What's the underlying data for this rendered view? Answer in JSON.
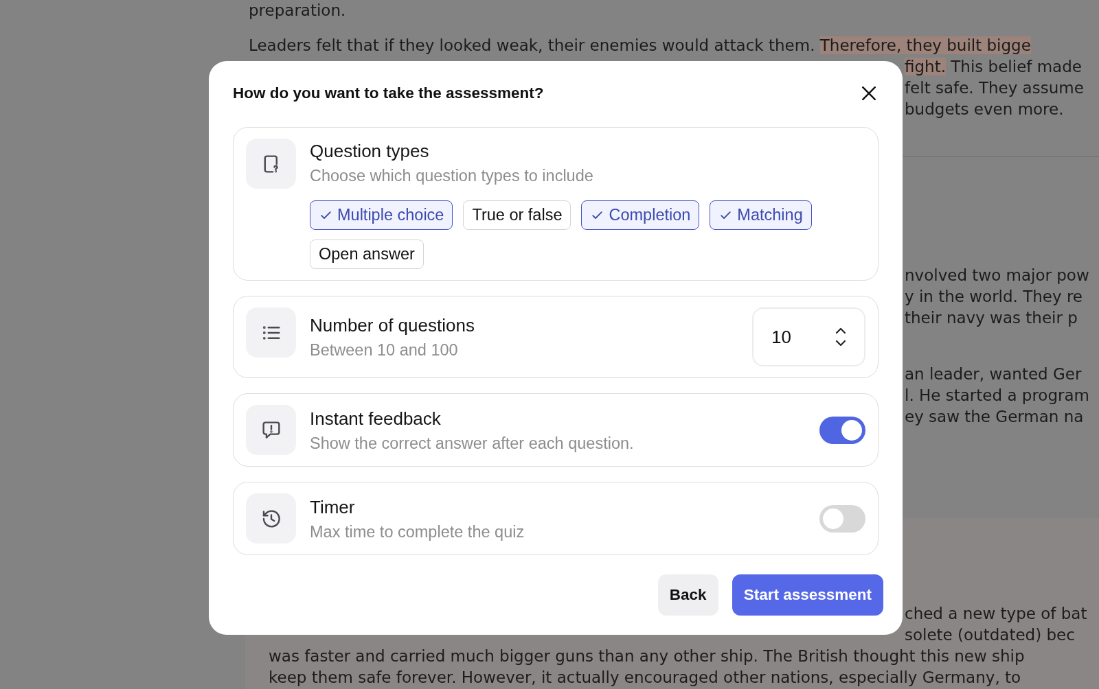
{
  "article": {
    "sections": [
      {
        "paragraphs": [
          {
            "lines": [
              {
                "kind": "full",
                "segments": [
                  {
                    "text": "preparation.",
                    "highlighted": false
                  }
                ]
              }
            ]
          },
          {
            "lines": [
              {
                "kind": "full",
                "segments": [
                  {
                    "text": "Leaders felt that if they looked weak, their enemies would attack them.",
                    "highlighted": false
                  },
                  {
                    "text": "Therefore, they built bigge",
                    "highlighted": true
                  }
                ]
              },
              {
                "kind": "right",
                "segments": [
                  {
                    "text": "fight.",
                    "highlighted": true
                  },
                  {
                    "text": "This belief made",
                    "highlighted": false
                  }
                ]
              },
              {
                "kind": "right",
                "segments": [
                  {
                    "text": "felt safe. They assume",
                    "highlighted": false
                  }
                ]
              },
              {
                "kind": "right",
                "segments": [
                  {
                    "text": "budgets even more.",
                    "highlighted": false
                  }
                ]
              }
            ]
          }
        ]
      },
      {
        "paragraphs": [
          {
            "lines": [
              {
                "kind": "right",
                "segments": [
                  {
                    "text": "nvolved two major pow",
                    "highlighted": false
                  }
                ]
              },
              {
                "kind": "right",
                "segments": [
                  {
                    "text": "y in the world. They re",
                    "highlighted": false
                  }
                ]
              },
              {
                "kind": "right",
                "segments": [
                  {
                    "text": "their navy was their p",
                    "highlighted": false
                  }
                ]
              }
            ]
          },
          {
            "lines": [
              {
                "kind": "right",
                "segments": [
                  {
                    "text": "an leader, wanted Ger",
                    "highlighted": false
                  }
                ]
              },
              {
                "kind": "right",
                "segments": [
                  {
                    "text": "l. He started a program",
                    "highlighted": false
                  }
                ]
              },
              {
                "kind": "right",
                "segments": [
                  {
                    "text": "ey saw the German na",
                    "highlighted": false
                  }
                ]
              }
            ]
          }
        ]
      }
    ],
    "callout": {
      "lines": [
        {
          "kind": "right",
          "segments": [
            {
              "text": "ched a new type of bat",
              "highlighted": false
            }
          ]
        },
        {
          "kind": "right",
          "segments": [
            {
              "text": "solete (outdated) bec",
              "highlighted": false
            }
          ]
        },
        {
          "kind": "full",
          "segments": [
            {
              "text": "was faster and carried much bigger guns than any other ship. The British thought this new ship",
              "highlighted": false
            }
          ]
        },
        {
          "kind": "full",
          "segments": [
            {
              "text": "keep them safe forever. However, it actually encouraged other nations, especially Germany, to",
              "highlighted": false
            }
          ]
        }
      ]
    }
  },
  "dialog": {
    "title": "How do you want to take the assessment?",
    "cards": [
      {
        "kind": "chips",
        "title": "Question types",
        "subtitle": "Choose which question types to include",
        "chips": [
          {
            "label": "Multiple choice",
            "selected": true
          },
          {
            "label": "True or false",
            "selected": false
          },
          {
            "label": "Completion",
            "selected": true
          },
          {
            "label": "Matching",
            "selected": true
          },
          {
            "label": "Open answer",
            "selected": false
          }
        ]
      },
      {
        "kind": "number",
        "title": "Number of questions",
        "subtitle": "Between 10 and 100",
        "value": "10"
      },
      {
        "kind": "toggle",
        "title": "Instant feedback",
        "subtitle": "Show the correct answer after each question.",
        "on": true
      },
      {
        "kind": "toggle",
        "title": "Timer",
        "subtitle": "Max time to complete the quiz",
        "on": false
      }
    ],
    "buttons": [
      {
        "kind": "secondary",
        "label": "Back"
      },
      {
        "kind": "primary",
        "label": "Start assessment"
      }
    ]
  }
}
